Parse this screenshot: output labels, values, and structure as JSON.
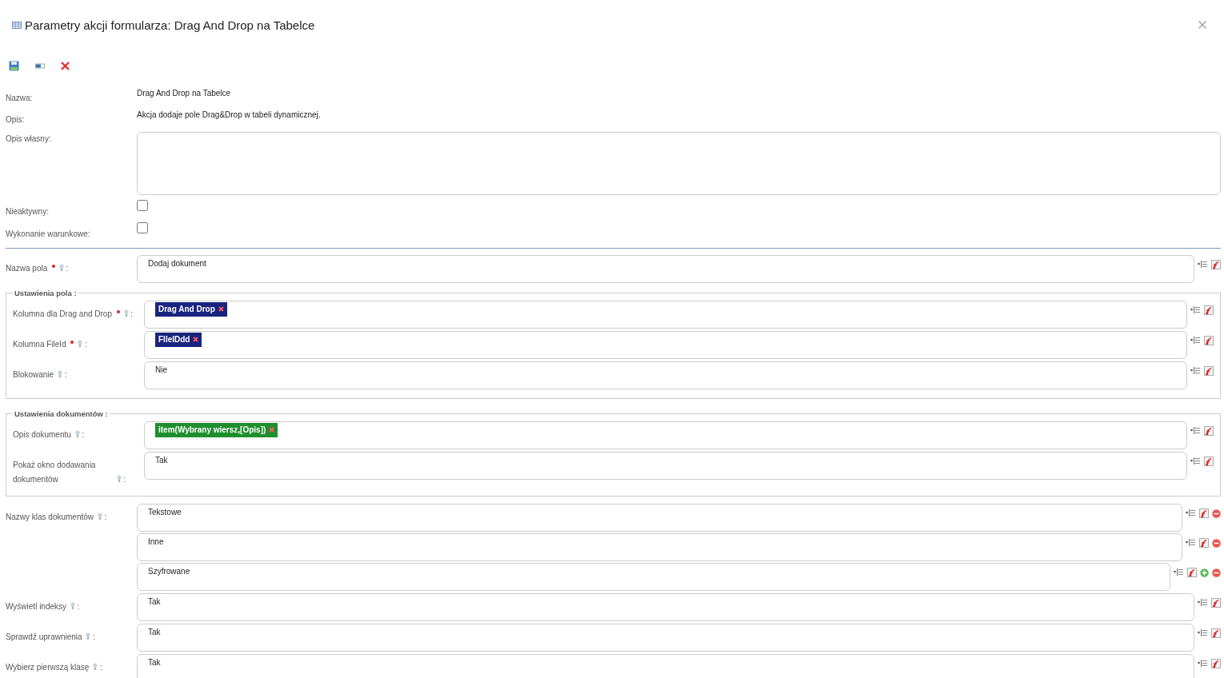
{
  "dialog": {
    "title": "Parametry akcji formularza: Drag And Drop na Tabelce"
  },
  "toolbar": [
    {
      "kind": "save"
    },
    {
      "kind": "panel"
    },
    {
      "kind": "delete"
    }
  ],
  "info": [
    {
      "label": "Nazwa:",
      "value": "Drag And Drop na Tabelce"
    },
    {
      "label": "Opis:",
      "value": "Akcja dodaje pole Drag&Drop w tabeli dynamicznej."
    }
  ],
  "own_description": {
    "label": "Opis własny:"
  },
  "flags": [
    {
      "label": "Nieaktywny:",
      "checked": false
    },
    {
      "label": "Wykonanie warunkowe:",
      "checked": false
    }
  ],
  "sections": [
    {
      "kind": "field",
      "label": "Nazwa pola",
      "required": true,
      "hint": true,
      "separator": ":",
      "value": "Dodaj dokument"
    },
    {
      "kind": "group",
      "legend": "Ustawienia pola :",
      "fields": [
        {
          "kind": "field",
          "label": "Kolumna dla Drag and Drop",
          "required": true,
          "hint": true,
          "separator": ":",
          "tags": [
            {
              "text": "Drag And Drop",
              "color": "#1a237e"
            }
          ]
        },
        {
          "kind": "field",
          "label": "Kolumna FileId",
          "required": true,
          "hint": true,
          "separator": ":",
          "tags": [
            {
              "text": "FIleIDdd",
              "color": "#1a237e"
            }
          ]
        },
        {
          "kind": "field",
          "label": "Blokowanie",
          "required": false,
          "hint": true,
          "separator": ":",
          "value": "Nie"
        }
      ]
    },
    {
      "kind": "group",
      "legend": "Ustawienia dokumentów :",
      "fields": [
        {
          "kind": "field",
          "label": "Opis dokumentu",
          "required": false,
          "hint": true,
          "separator": ":",
          "tags": [
            {
              "text": "item(Wybrany wiersz,[Opis])",
              "color": "#1e8e2e"
            }
          ]
        },
        {
          "kind": "field",
          "label": "Pokaż okno dodawania dokumentów",
          "required": false,
          "hint": true,
          "separator": ":",
          "value": "Tak"
        }
      ]
    },
    {
      "kind": "multi",
      "label": "Nazwy klas dokumentów",
      "required": false,
      "hint": true,
      "separator": ":",
      "values": [
        {
          "value": "Tekstowe",
          "actions": [
            {
              "kind": "remove"
            }
          ]
        },
        {
          "value": "Inne",
          "actions": [
            {
              "kind": "remove"
            }
          ]
        },
        {
          "value": "Szyfrowane",
          "actions": [
            {
              "kind": "add"
            },
            {
              "kind": "remove"
            }
          ]
        }
      ]
    },
    {
      "kind": "field",
      "label": "Wyświetl indeksy",
      "required": false,
      "hint": true,
      "separator": ":",
      "value": "Tak"
    },
    {
      "kind": "field",
      "label": "Sprawdź uprawnienia",
      "required": false,
      "hint": true,
      "separator": ":",
      "value": "Tak"
    },
    {
      "kind": "field",
      "label": "Wybierz pierwszą klasę",
      "required": false,
      "hint": true,
      "separator": ":",
      "value": "Tak"
    }
  ]
}
